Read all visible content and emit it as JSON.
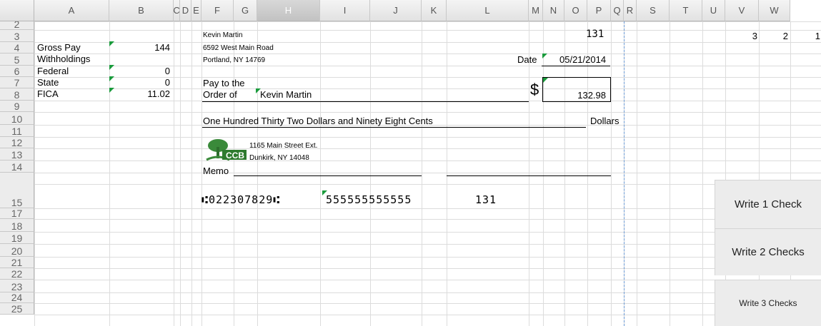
{
  "columns": [
    "A",
    "B",
    "C",
    "D",
    "E",
    "F",
    "G",
    "H",
    "I",
    "J",
    "K",
    "L",
    "M",
    "N",
    "O",
    "P",
    "Q",
    "R",
    "S",
    "T",
    "U",
    "V",
    "W"
  ],
  "rows": [
    "2",
    "3",
    "4",
    "5",
    "6",
    "7",
    "8",
    "9",
    "10",
    "11",
    "12",
    "13",
    "14",
    "15",
    "17",
    "18",
    "19",
    "20",
    "21",
    "22",
    "23",
    "24",
    "25"
  ],
  "sheet": {
    "labels": {
      "gross_pay": "Gross Pay",
      "withholdings": "Withholdings",
      "federal": "Federal",
      "state": "State",
      "fica": "FICA"
    },
    "values": {
      "gross_pay": "144",
      "federal": "0",
      "state": "0",
      "fica": "11.02"
    },
    "u2": "3",
    "v2": "2",
    "w2": "1"
  },
  "check": {
    "payer_name": "Kevin Martin",
    "payer_address1": "6592 West Main Road",
    "payer_address2": "Portland, NY 14769",
    "check_number": "131",
    "date_label": "Date",
    "date": "05/21/2014",
    "pay_to_line1": "Pay to the",
    "pay_to_line2": "Order of",
    "payee": "Kevin Martin",
    "dollar_sign": "$",
    "amount": "132.98",
    "amount_words": "One Hundred Thirty Two Dollars and Ninety Eight Cents",
    "dollars_label": "Dollars",
    "bank_logo_text": "CCB",
    "bank_address1": "1165 Main Street Ext.",
    "bank_address2": "Dunkirk, NY 14048",
    "memo_label": "Memo",
    "micr_routing": "⑆022307829⑆",
    "micr_account": "555555555555",
    "micr_check": "131"
  },
  "buttons": {
    "write1": "Write 1 Check",
    "write2": "Write 2 Checks",
    "write3": "Write 3 Checks"
  },
  "colors": {
    "grid": "#dcdcdc",
    "marker": "#1a9b3c",
    "page_break": "#6a9ad6",
    "logo_green": "#3a8a3a"
  }
}
